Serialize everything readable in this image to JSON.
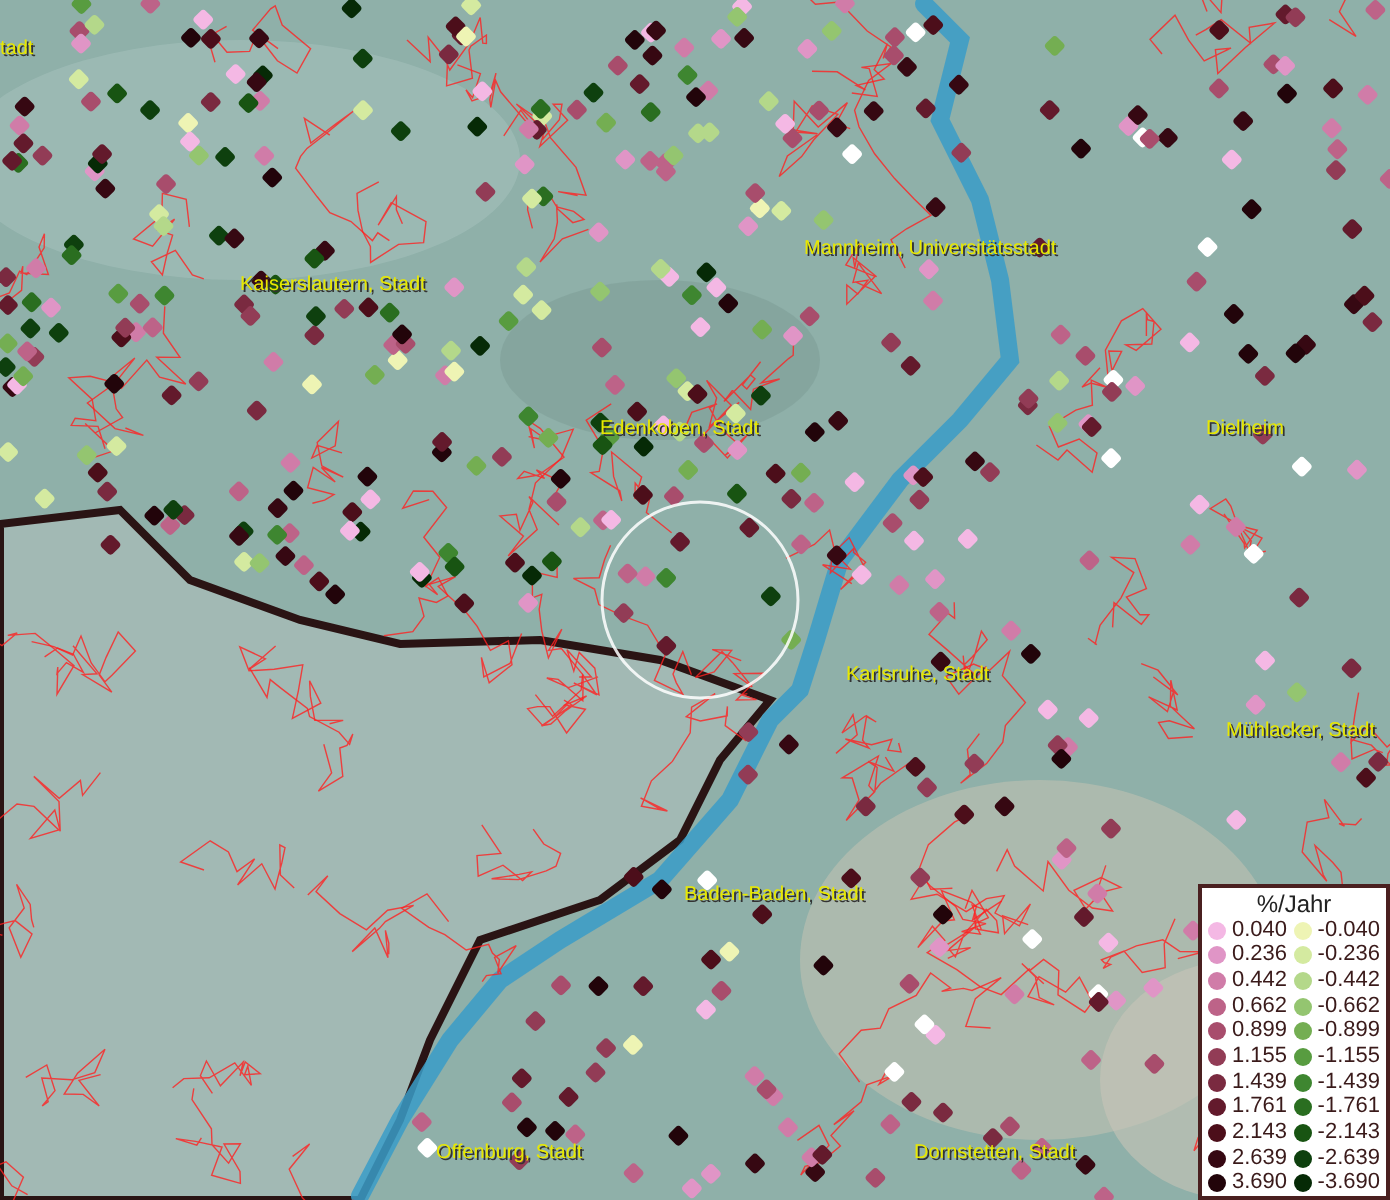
{
  "map_labels": [
    {
      "text": "tadt"
    },
    {
      "text": "Kaiserslautern, Stadt"
    },
    {
      "text": "Mannheim, Universitätsstadt"
    },
    {
      "text": "Edenkoben, Stadt"
    },
    {
      "text": "Dielheim"
    },
    {
      "text": "Karlsruhe, Stadt"
    },
    {
      "text": "Mühlacker, Stadt"
    },
    {
      "text": "Baden-Baden, Stadt"
    },
    {
      "text": "Offenburg, Stadt"
    },
    {
      "text": "Dornstetten, Stadt"
    }
  ],
  "legend": {
    "title": "%/Jahr",
    "positive": [
      {
        "label": "0.040",
        "color": "#f4b8e4"
      },
      {
        "label": "0.236",
        "color": "#e095c6"
      },
      {
        "label": "0.442",
        "color": "#d07ca8"
      },
      {
        "label": "0.662",
        "color": "#bd6388"
      },
      {
        "label": "0.899",
        "color": "#a84d6c"
      },
      {
        "label": "1.155",
        "color": "#923c56"
      },
      {
        "label": "1.439",
        "color": "#7a2a40"
      },
      {
        "label": "1.761",
        "color": "#631a2c"
      },
      {
        "label": "2.143",
        "color": "#4c0e1a"
      },
      {
        "label": "2.639",
        "color": "#360812"
      },
      {
        "label": "3.690",
        "color": "#22040a"
      }
    ],
    "negative": [
      {
        "label": "-0.040",
        "color": "#eef4b4"
      },
      {
        "label": "-0.236",
        "color": "#d4eaa0"
      },
      {
        "label": "-0.442",
        "color": "#b4d88a"
      },
      {
        "label": "-0.662",
        "color": "#94c570"
      },
      {
        "label": "-0.899",
        "color": "#74ae52"
      },
      {
        "label": "-1.155",
        "color": "#589c40"
      },
      {
        "label": "-1.439",
        "color": "#3e8630"
      },
      {
        "label": "-1.761",
        "color": "#2a6e20"
      },
      {
        "label": "-2.143",
        "color": "#185412"
      },
      {
        "label": "-2.639",
        "color": "#0e400e"
      },
      {
        "label": "-3.690",
        "color": "#062a06"
      }
    ]
  }
}
